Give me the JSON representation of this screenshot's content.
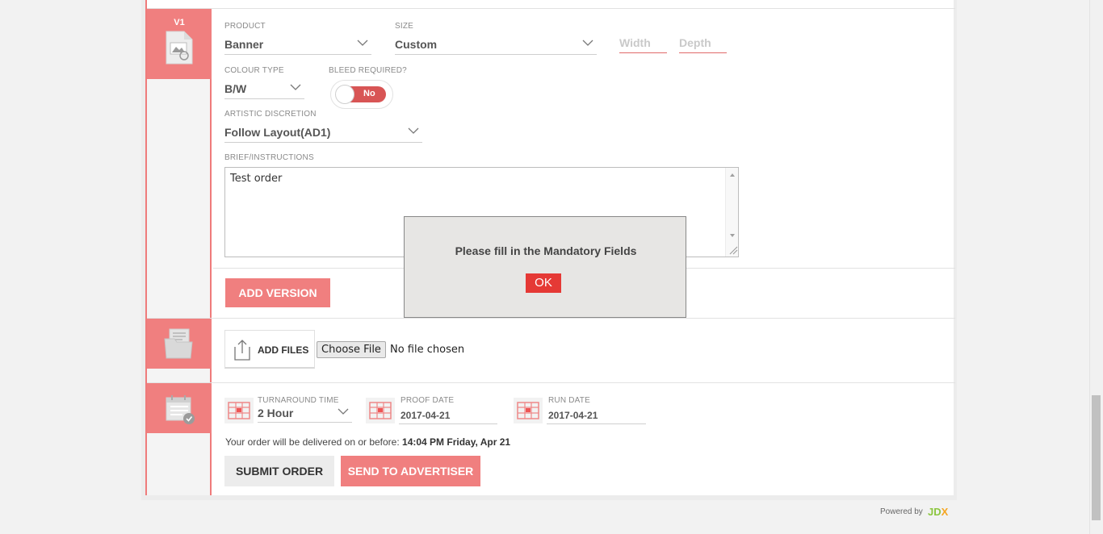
{
  "version": {
    "tag": "V1"
  },
  "fields": {
    "product": {
      "label": "PRODUCT",
      "value": "Banner"
    },
    "size": {
      "label": "SIZE",
      "value": "Custom"
    },
    "width": {
      "placeholder": "Width"
    },
    "depth": {
      "placeholder": "Depth"
    },
    "colour_type": {
      "label": "COLOUR TYPE",
      "value": "B/W"
    },
    "bleed": {
      "label": "BLEED REQUIRED?",
      "value": "No"
    },
    "artistic": {
      "label": "ARTISTIC DISCRETION",
      "value": "Follow Layout(AD1)"
    },
    "brief": {
      "label": "BRIEF/INSTRUCTIONS",
      "value": "Test order"
    }
  },
  "buttons": {
    "add_version": "ADD VERSION",
    "add_files": "ADD FILES",
    "choose_file": "Choose File",
    "submit_order": "SUBMIT ORDER",
    "send_to_advertiser": "SEND TO ADVERTISER"
  },
  "file_status": "No file chosen",
  "schedule": {
    "turnaround": {
      "label": "TURNAROUND TIME",
      "value": "2 Hour"
    },
    "proof_date": {
      "label": "PROOF DATE",
      "value": "2017-04-21"
    },
    "run_date": {
      "label": "RUN DATE",
      "value": "2017-04-21"
    },
    "delivery_prefix": "Your order will be delivered on or before:",
    "delivery_time": "14:04 PM Friday, Apr 21"
  },
  "modal": {
    "message": "Please fill in the Mandatory Fields",
    "ok": "OK"
  },
  "footer": {
    "powered_by": "Powered by",
    "brand_a": "JD",
    "brand_b": "X"
  },
  "colors": {
    "accent": "#f07f7f",
    "toggle": "#d85555",
    "ok": "#e53935",
    "brand_green": "#8cc63f",
    "brand_orange": "#f5a623"
  },
  "icons": [
    "image-file-icon",
    "folder-icon",
    "calendar-check-icon",
    "upload-icon",
    "chevron-down-icon",
    "calendar-icon"
  ]
}
